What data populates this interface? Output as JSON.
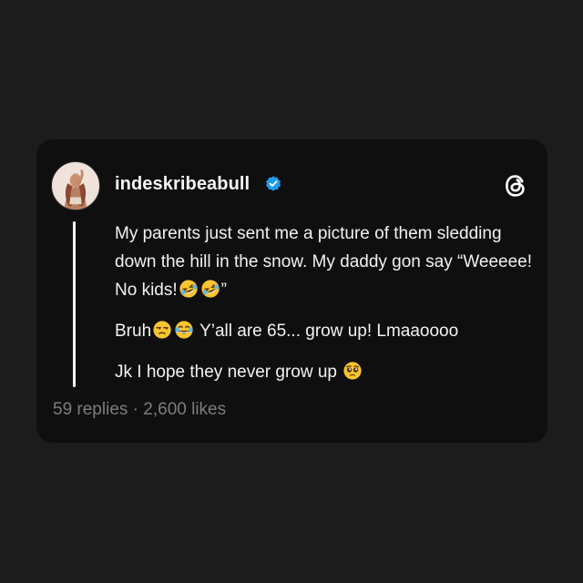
{
  "post": {
    "username": "indeskribeabull",
    "paragraphs": {
      "p1_a": "My parents just sent me a picture of them sledding down the hill in the snow. My daddy gon say “Weeeee! No kids!",
      "p1_b": "”",
      "p2_a": "Bruh",
      "p2_b": " Y’all are 65... grow up! Lmaaoooo",
      "p3_a": "Jk I hope they never grow up "
    },
    "stats": {
      "replies": "59 replies",
      "separator": " · ",
      "likes": "2,600 likes"
    }
  },
  "icons": {
    "verified": "verified-badge-icon",
    "threads": "threads-logo-icon",
    "emojis": [
      "rolling-on-floor-laughing",
      "rolling-on-floor-laughing",
      "unamused-face",
      "face-with-tears-of-joy",
      "pleading-face"
    ]
  },
  "colors": {
    "background": "#1c1c1c",
    "card": "#0f0f0f",
    "text": "#f2f2f2",
    "muted": "#7d7d7d",
    "verified": "#1d9bf0"
  }
}
